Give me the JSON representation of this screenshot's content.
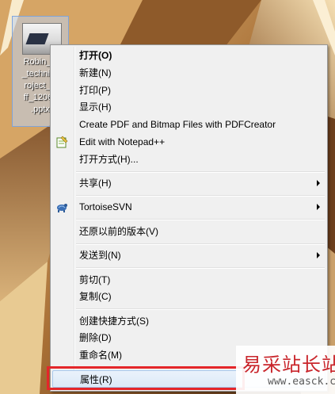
{
  "desktop": {
    "file": {
      "name_lines": [
        "Robin_U",
        "_technica",
        "roject_ki",
        "ff_12062",
        ".pptx"
      ],
      "icon": "pptx-file-icon"
    }
  },
  "context_menu": {
    "items": [
      {
        "label": "打开(O)",
        "bold": true
      },
      {
        "label": "新建(N)"
      },
      {
        "label": "打印(P)"
      },
      {
        "label": "显示(H)"
      },
      {
        "label": "Create PDF and Bitmap Files with PDFCreator"
      },
      {
        "label": "Edit with Notepad++",
        "icon": "notepad-plus-plus-icon"
      },
      {
        "label": "打开方式(H)..."
      },
      {
        "label": "共享(H)",
        "submenu": true
      },
      {
        "label": "TortoiseSVN",
        "submenu": true,
        "icon": "tortoise-svn-icon"
      },
      {
        "label": "还原以前的版本(V)"
      },
      {
        "label": "发送到(N)",
        "submenu": true
      },
      {
        "label": "剪切(T)"
      },
      {
        "label": "复制(C)"
      },
      {
        "label": "创建快捷方式(S)"
      },
      {
        "label": "删除(D)"
      },
      {
        "label": "重命名(M)"
      },
      {
        "label": "属性(R)",
        "highlighted": true
      }
    ]
  },
  "watermark": {
    "chinese": "易采站长站",
    "english": "www.easck.com"
  },
  "colors": {
    "menu_background": "#f0f0f0",
    "highlight_border": "#e4262a",
    "watermark_red": "#c9252b"
  }
}
